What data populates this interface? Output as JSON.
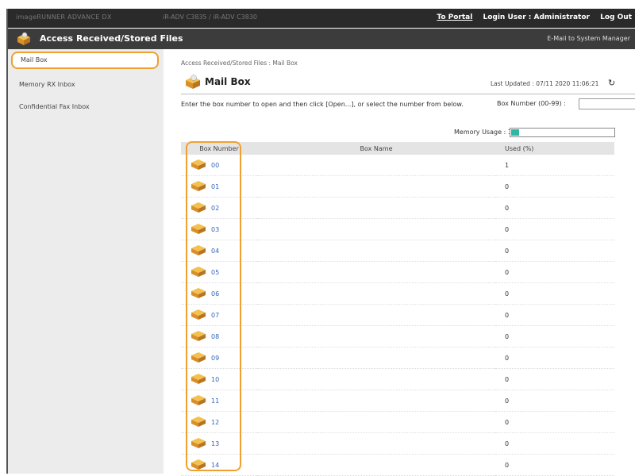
{
  "header": {
    "model": "imageRUNNER ADVANCE DX",
    "device": "iR-ADV C3835 / iR-ADV C3830",
    "to_portal": "To Portal",
    "login_user": "Login User : Administrator",
    "log_out": "Log Out"
  },
  "titlebar": {
    "title": "Access Received/Stored Files",
    "email_link": "E-Mail to System Manager"
  },
  "sidebar": {
    "items": [
      {
        "label": "Mail Box",
        "selected": true
      },
      {
        "label": "Memory RX Inbox",
        "selected": false
      },
      {
        "label": "Confidential Fax Inbox",
        "selected": false
      }
    ]
  },
  "main": {
    "breadcrumb": "Access Received/Stored Files : Mail Box",
    "page_title": "Mail Box",
    "last_updated": "Last Updated : 07/11 2020 11:06:21",
    "instruction": "Enter the box number to open and then click [Open...], or select the number from below.",
    "box_number_label": "Box Number (00-99) :",
    "box_number_value": "",
    "memory_usage_label": "Memory Usage : 1%",
    "memory_usage_percent": 1
  },
  "table": {
    "headers": {
      "box_number": "Box Number",
      "box_name": "Box Name",
      "used": "Used (%)"
    },
    "rows": [
      {
        "number": "00",
        "name": "",
        "used": "1"
      },
      {
        "number": "01",
        "name": "",
        "used": "0"
      },
      {
        "number": "02",
        "name": "",
        "used": "0"
      },
      {
        "number": "03",
        "name": "",
        "used": "0"
      },
      {
        "number": "04",
        "name": "",
        "used": "0"
      },
      {
        "number": "05",
        "name": "",
        "used": "0"
      },
      {
        "number": "06",
        "name": "",
        "used": "0"
      },
      {
        "number": "07",
        "name": "",
        "used": "0"
      },
      {
        "number": "08",
        "name": "",
        "used": "0"
      },
      {
        "number": "09",
        "name": "",
        "used": "0"
      },
      {
        "number": "10",
        "name": "",
        "used": "0"
      },
      {
        "number": "11",
        "name": "",
        "used": "0"
      },
      {
        "number": "12",
        "name": "",
        "used": "0"
      },
      {
        "number": "13",
        "name": "",
        "used": "0"
      },
      {
        "number": "14",
        "name": "",
        "used": "0"
      }
    ]
  },
  "colors": {
    "topbar": "#2a2a2a",
    "titlebar": "#3c3c3c",
    "highlight": "#f0a030",
    "link": "#3366bb",
    "memory_fill": "#2db7a4"
  },
  "icons": {
    "header": "mailbox-icon",
    "box": "box-icon",
    "refresh": "refresh-icon"
  }
}
